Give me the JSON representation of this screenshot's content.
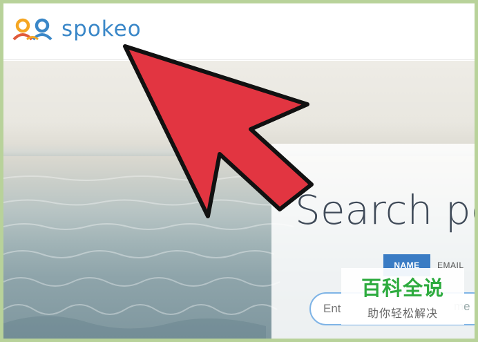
{
  "header": {
    "logo_text": "spokeo"
  },
  "hero": {
    "title": "Search pe",
    "tabs": [
      {
        "label": "NAME",
        "active": true
      },
      {
        "label": "EMAIL",
        "active": false
      }
    ],
    "search": {
      "placeholder": "Ent",
      "hint_suffix": "me"
    }
  },
  "watermark": {
    "title": "百科全说",
    "subtitle": "助你轻松解决"
  },
  "colors": {
    "brand_blue": "#3a87c8",
    "logo_orange": "#f5a623",
    "tab_active": "#3a7cc4",
    "arrow_red": "#e23541",
    "watermark_green": "#2dab3e",
    "frame_green": "#b8d29a"
  },
  "icons": {
    "logo": "spokeo-people-logo-icon",
    "annotation": "red-pointer-arrow-icon"
  }
}
